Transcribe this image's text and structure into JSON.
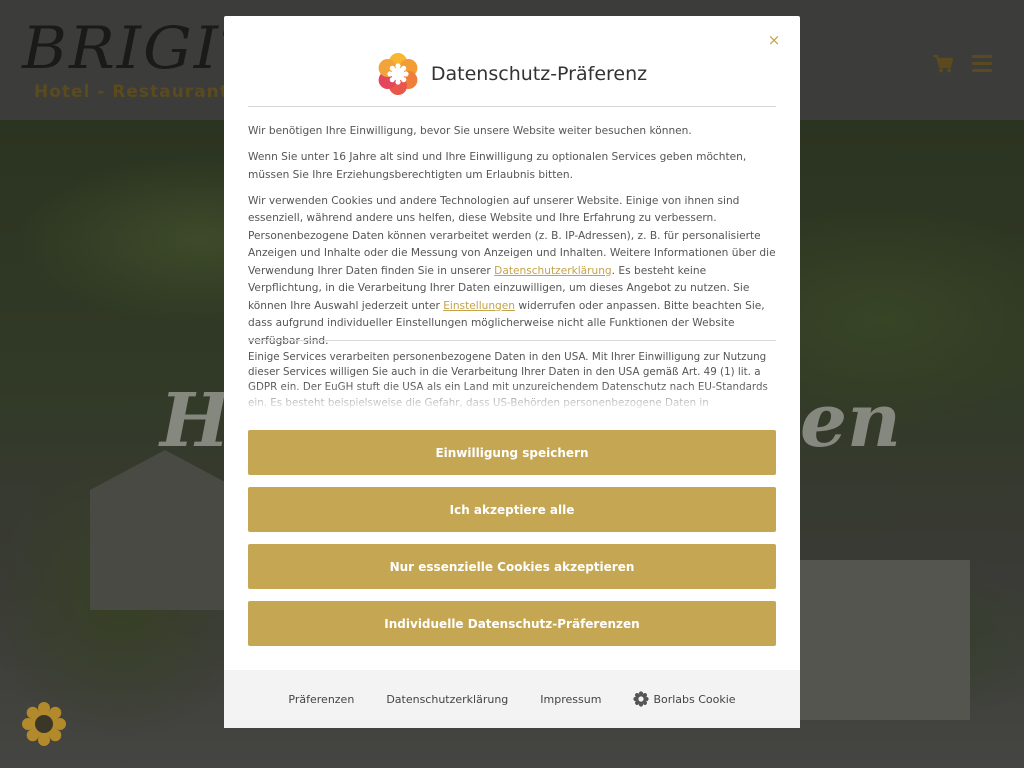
{
  "site": {
    "logo_text": "BRIGITTE",
    "logo_subtitle": "Hotel - Restaurant",
    "hero_title_start": "H",
    "hero_title_end": "en"
  },
  "modal": {
    "title": "Datenschutz-Präferenz",
    "close_label": "×",
    "intro": "Wir benötigen Ihre Einwilligung, bevor Sie unsere Website weiter besuchen können.",
    "age_notice": "Wenn Sie unter 16 Jahre alt sind und Ihre Einwilligung zu optionalen Services geben möchten, müssen Sie Ihre Erziehungsberechtigten um Erlaubnis bitten.",
    "cookies_part1": "Wir verwenden Cookies und andere Technologien auf unserer Website. Einige von ihnen sind essenziell, während andere uns helfen, diese Website und Ihre Erfahrung zu verbessern. Personenbezogene Daten können verarbeitet werden (z. B. IP-Adressen), z. B. für personalisierte Anzeigen und Inhalte oder die Messung von Anzeigen und Inhalten. Weitere Informationen über die Verwendung Ihrer Daten finden Sie in unserer ",
    "privacy_link": "Datenschutzerklärung",
    "cookies_part2": ". Es besteht keine Verpflichtung, in die Verarbeitung Ihrer Daten einzuwilligen, um dieses Angebot zu nutzen. Sie können Ihre Auswahl jederzeit unter ",
    "settings_link": "Einstellungen",
    "cookies_part3": " widerrufen oder anpassen. Bitte beachten Sie, dass aufgrund individueller Einstellungen möglicherweise nicht alle Funktionen der Website verfügbar sind.",
    "usa_notice": "Einige Services verarbeiten personenbezogene Daten in den USA. Mit Ihrer Einwilligung zur Nutzung dieser Services willigen Sie auch in die Verarbeitung Ihrer Daten in den USA gemäß Art. 49 (1) lit. a GDPR ein. Der EuGH stuft die USA als ein Land mit unzureichendem Datenschutz nach EU-Standards ein. Es besteht beispielsweise die Gefahr, dass US-Behörden personenbezogene Daten in",
    "buttons": {
      "save": "Einwilligung speichern",
      "accept_all": "Ich akzeptiere alle",
      "essential_only": "Nur essenzielle Cookies akzeptieren",
      "individual": "Individuelle Datenschutz-Präferenzen"
    },
    "footer": {
      "preferences": "Präferenzen",
      "privacy": "Datenschutzerklärung",
      "imprint": "Impressum",
      "borlabs": "Borlabs Cookie"
    }
  },
  "colors": {
    "accent": "#c5a753",
    "link": "#c5a34a",
    "footer_bg": "#f3f3f3"
  },
  "icons": [
    "cart-icon",
    "menu-icon",
    "brand-logo-icon",
    "close-icon",
    "borlabs-cookie-icon",
    "floating-cookie-icon"
  ]
}
